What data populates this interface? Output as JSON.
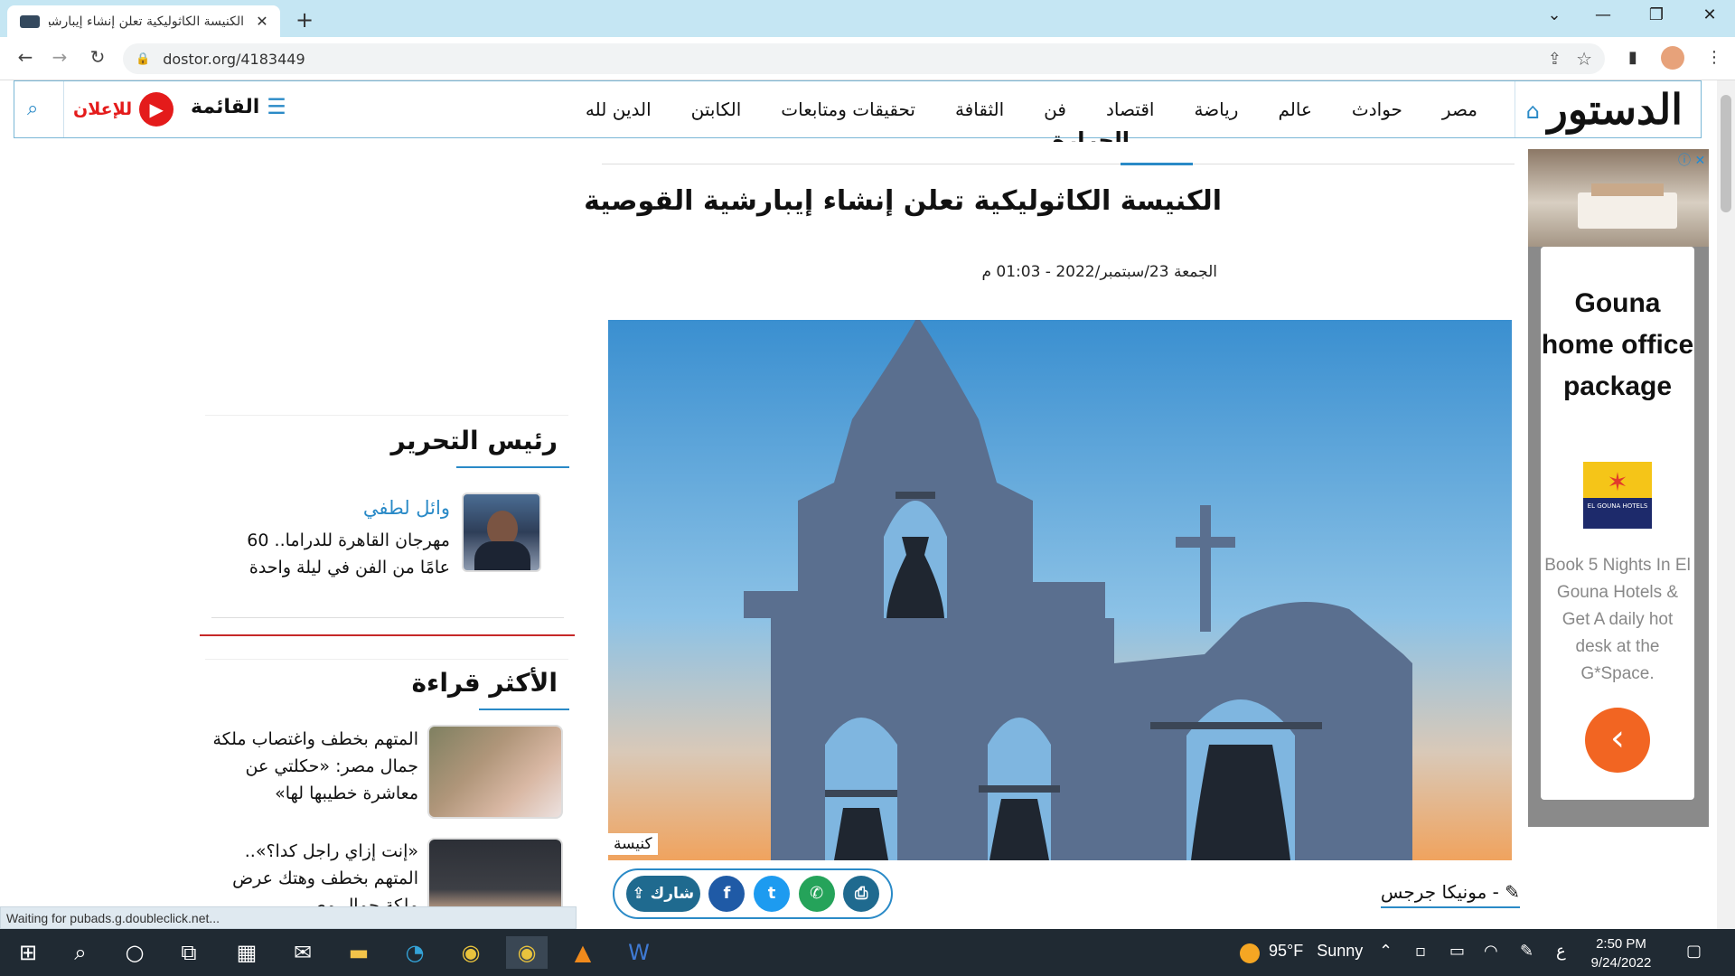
{
  "browser": {
    "tab_title": "الكنيسة الكاثوليكية تعلن إنشاء إيبارشية",
    "tab_close": "✕",
    "new_tab": "+",
    "url": "dostor.org/4183449",
    "window_controls": {
      "dropdown": "⌄",
      "minimize": "—",
      "restore": "❐",
      "close": "✕"
    }
  },
  "site": {
    "logo": "الدستور",
    "nav_items": [
      "مصر",
      "حوادث",
      "عالم",
      "رياضة",
      "اقتصاد",
      "فن",
      "الثقافة",
      "تحقيقات ومتابعات",
      "الكابتن",
      "الدين لله"
    ],
    "menu_label": "القائمة",
    "ad_label": "للإعلان"
  },
  "article": {
    "section_cut": "الحرارة",
    "headline": "الكنيسة الكاثوليكية تعلن إنشاء إيبارشية القوصية",
    "dateline": "الجمعة 23/سبتمبر/2022 - 01:03 م",
    "image_caption": "كنيسة",
    "share_label": "شارك",
    "author": "- مونيكا جرجس"
  },
  "ad": {
    "headline": "Gouna home office package",
    "logo_text": "EL GOUNA HOTELS",
    "body": "Book 5 Nights In El Gouna Hotels & Get A daily hot desk at the G*Space.",
    "info": "ⓘ",
    "close": "✕"
  },
  "sidebar": {
    "editor_heading": "رئيس التحرير",
    "editor_name": "وائل لطفي",
    "editor_article": "مهرجان القاهرة للدراما.. 60 عامًا من الفن في ليلة واحدة",
    "most_read_heading": "الأكثر قراءة",
    "most_read": [
      {
        "title": "المتهم بخطف واغتصاب ملكة جمال مصر: «حكلتي عن معاشرة خطيبها لها»"
      },
      {
        "title": "«إنت إزاي راجل كدا؟».. المتهم بخطف وهتك عرض ملكة جمال مصر"
      }
    ]
  },
  "status_text": "Waiting for pubads.g.doubleclick.net...",
  "taskbar": {
    "weather_temp": "95°F",
    "weather_desc": "Sunny",
    "time": "2:50 PM",
    "date": "9/24/2022",
    "lang": "ع"
  }
}
